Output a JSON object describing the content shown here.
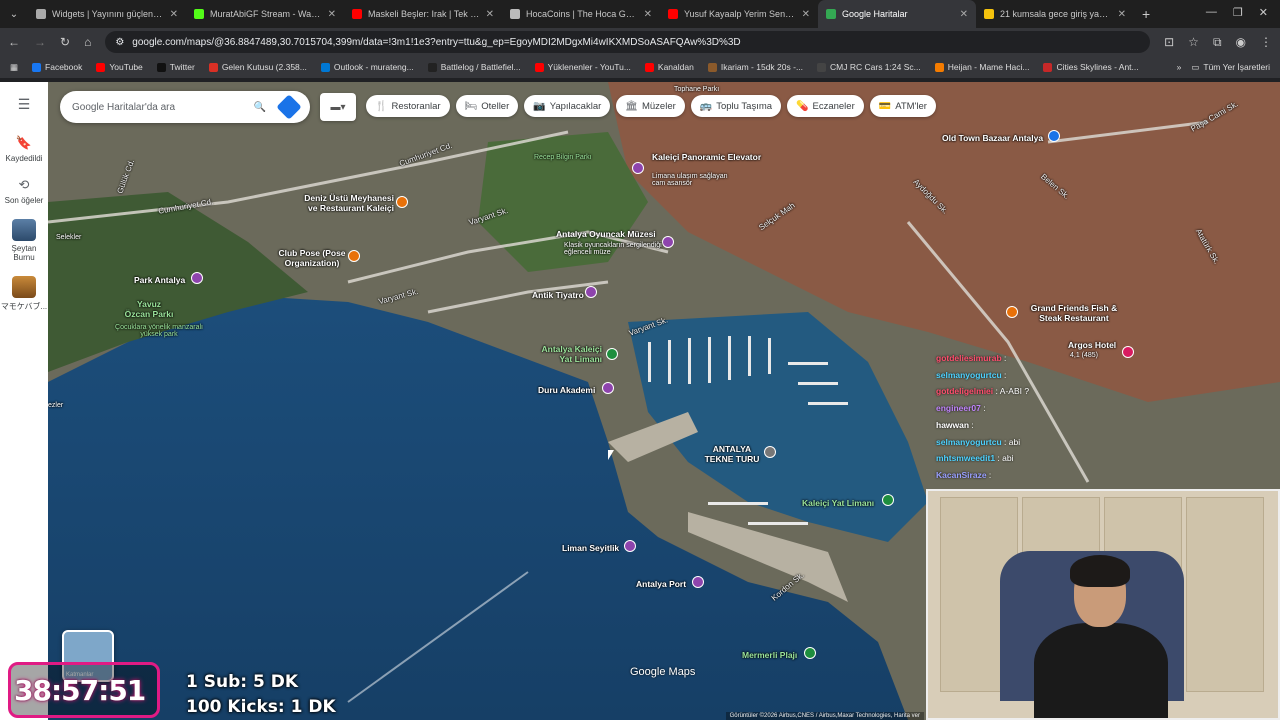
{
  "browser": {
    "tabs": [
      {
        "title": "Widgets | Yayınını güçlendirmek",
        "color": "#aaaaaa",
        "active": false
      },
      {
        "title": "MuratAbiGF Stream - Watch Li...",
        "color": "#53fc18",
        "active": false
      },
      {
        "title": "Maskeli Beşler: Irak | Tek Parça",
        "color": "#ff0000",
        "active": false
      },
      {
        "title": "HocaCoins | The Hoca Games",
        "color": "#bbbbbb",
        "active": false
      },
      {
        "title": "Yusuf Kayaalp Yerim Seni (Al Cl",
        "color": "#ff0000",
        "active": false
      },
      {
        "title": "Google Haritalar",
        "color": "#34a853",
        "active": true
      },
      {
        "title": "21 kumsala gece giriş yasakı Ce",
        "color": "#f4c20d",
        "active": false
      }
    ],
    "url": "google.com/maps/@36.8847489,30.7015704,399m/data=!3m1!1e3?entry=ttu&g_ep=EgoyMDI2MDgxMi4wIKXMDSoASAFQAw%3D%3D",
    "bookmarks": [
      {
        "label": "Facebook",
        "color": "#1877f2"
      },
      {
        "label": "YouTube",
        "color": "#ff0000"
      },
      {
        "label": "Twitter",
        "color": "#111111"
      },
      {
        "label": "Gelen Kutusu (2.358...",
        "color": "#d93025"
      },
      {
        "label": "Outlook - murateng...",
        "color": "#0078d4"
      },
      {
        "label": "Battlelog / Battlefiel...",
        "color": "#222222"
      },
      {
        "label": "Yüklenenler - YouTu...",
        "color": "#ff0000"
      },
      {
        "label": "Kanaldan",
        "color": "#ff0000"
      },
      {
        "label": "Ikariam - 15dk 20s -...",
        "color": "#8b5a2b"
      },
      {
        "label": "CMJ RC Cars 1:24 Sc...",
        "color": "#444444"
      },
      {
        "label": "Heijan - Mame Haci...",
        "color": "#f57c00"
      },
      {
        "label": "Cities Skylines - Ant...",
        "color": "#c62828"
      }
    ],
    "all_bookmarks": "Tüm Yer İşaretleri"
  },
  "maps": {
    "rail": [
      {
        "label": "Kaydedildi",
        "icon": "bookmark-icon"
      },
      {
        "label": "Son öğeler",
        "icon": "history-icon"
      },
      {
        "label": "Şeytan Burnu",
        "icon": "place-thumb"
      },
      {
        "label": "マモケバブ...",
        "icon": "place-thumb"
      }
    ],
    "search_placeholder": "Google Haritalar'da ara",
    "chips": [
      {
        "label": "Restoranlar",
        "icon": "🍴"
      },
      {
        "label": "Oteller",
        "icon": "🛏"
      },
      {
        "label": "Yapılacaklar",
        "icon": "📷"
      },
      {
        "label": "Müzeler",
        "icon": "🏛"
      },
      {
        "label": "Toplu Taşıma",
        "icon": "🚌"
      },
      {
        "label": "Eczaneler",
        "icon": "💊"
      },
      {
        "label": "ATM'ler",
        "icon": "💳"
      }
    ],
    "roads": [
      "Cumhuriyet Cd.",
      "Cumhuriyet Cd.",
      "Varyant Sk.",
      "Varyant Sk.",
      "Varyant Sk.",
      "Gülük Cd.",
      "Selçuk Mah",
      "Aydoğdu Sk.",
      "Belen Sk.",
      "Paşa Cami Sk.",
      "Atatürk Sk.",
      "Kordon Sk."
    ],
    "labels": {
      "topane": "Tophane Parkı",
      "recep": "Recep Bilgin Parkı",
      "kaleici_elevator": "Kaleiçi Panoramic Elevator",
      "elevator_sub": "Limana ulaşım sağlayan cam asansör",
      "deniz": "Deniz Üstü Meyhanesi ve Restaurant Kaleiçi",
      "oyuncak": "Antalya Oyuncak Müzesi",
      "oyuncak_sub": "Klasik oyuncakların sergilendiği eğlenceli müze",
      "club": "Club Pose (Pose Organization)",
      "park": "Park Antalya",
      "yavuz": "Yavuz Özcan Parkı",
      "yavuz_sub": "Çocuklara yönelik manzaralı yüksek park",
      "antik": "Antik Tiyatro",
      "yat": "Antalya Kaleiçi Yat Limanı",
      "duru": "Duru Akademi",
      "tekne": "ANTALYA TEKNE TURU",
      "kaleici_yat": "Kaleiçi Yat Limanı",
      "liman": "Liman Seyitlik",
      "port": "Antalya Port",
      "mermerli": "Mermerli Plajı",
      "oldtown": "Old Town Bazaar Antalya",
      "grand": "Grand Friends Fish & Steak Restaurant",
      "argos": "Argos Hotel",
      "argos_rating": "4,1 (485)",
      "selekler": "Selekler",
      "ezler": "ezler"
    },
    "brand": "Google Maps",
    "attribution": "Görüntüler ©2026 Airbus,CNES / Airbus,Maxar Technologies, Harita ver",
    "layers_label": "Katmanlar"
  },
  "chat": [
    {
      "user": "gotdeliesimurab",
      "msg": "",
      "color": "#ff4d6d"
    },
    {
      "user": "selmanyogurtcu",
      "msg": "",
      "color": "#4dd2ff"
    },
    {
      "user": "gotdeligelmiei",
      "msg": "A-ABI ?",
      "color": "#ff4d6d"
    },
    {
      "user": "engineer07",
      "msg": "",
      "color": "#c084fc"
    },
    {
      "user": "hawwan",
      "msg": "",
      "color": "#ffffff"
    },
    {
      "user": "selmanyogurtcu",
      "msg": "abi",
      "color": "#4dd2ff"
    },
    {
      "user": "mhtsmweedit1",
      "msg": "abi",
      "color": "#4dd2ff"
    },
    {
      "user": "KacanSiraze",
      "msg": "",
      "color": "#9aa0ff"
    }
  ],
  "stream": {
    "timer": "38:57:51",
    "sub_line": "1 Sub: 5 DK",
    "kicks_line": "100 Kicks: 1 DK"
  }
}
